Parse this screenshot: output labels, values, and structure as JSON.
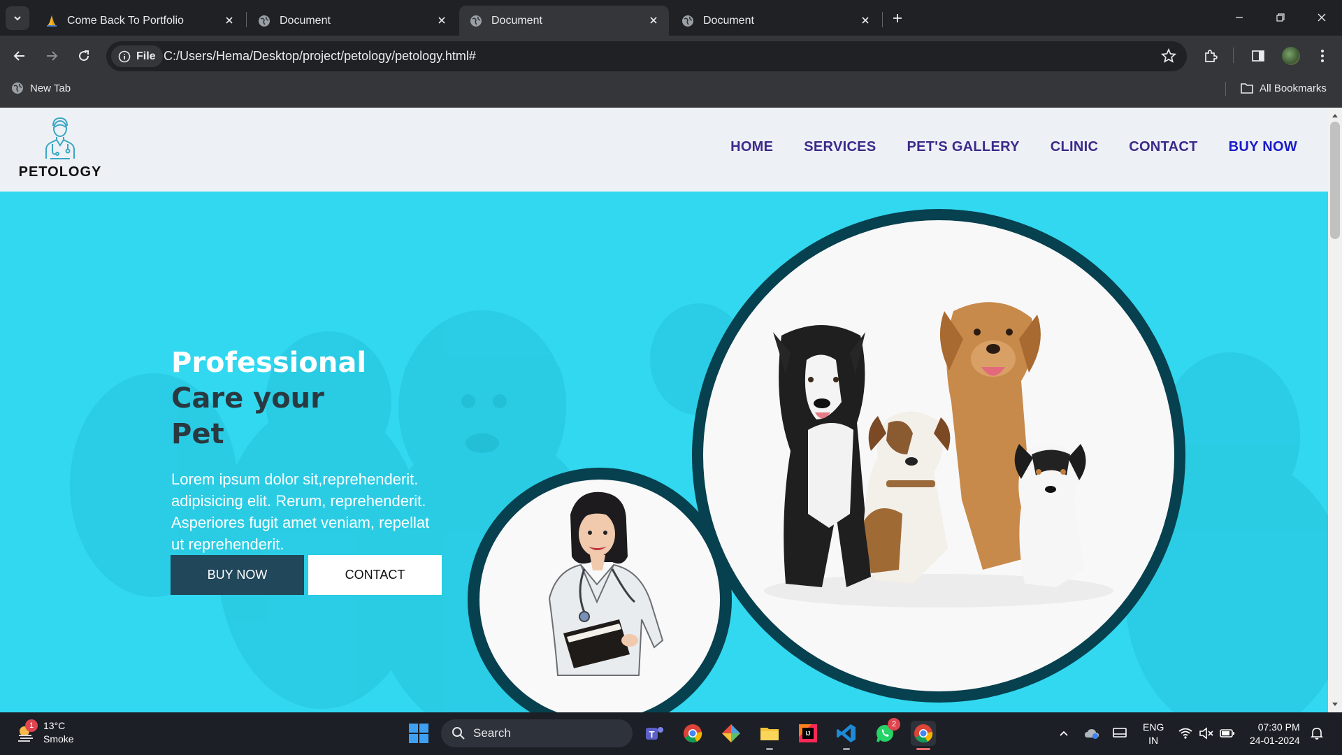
{
  "browser": {
    "tabs": [
      {
        "title": "Come Back To Portfolio",
        "active": false
      },
      {
        "title": "Document",
        "active": false
      },
      {
        "title": "Document",
        "active": true
      },
      {
        "title": "Document",
        "active": false
      }
    ],
    "site_chip": "File",
    "url": "C:/Users/Hema/Desktop/project/petology/petology.html#",
    "bookmarks": {
      "left": "New Tab",
      "right": "All Bookmarks"
    }
  },
  "site": {
    "logo_text": "PETOLOGY",
    "nav": [
      "HOME",
      "SERVICES",
      "PET'S GALLERY",
      "CLINIC",
      "CONTACT",
      "BUY NOW"
    ],
    "hero": {
      "title_line1": "Professional",
      "title_line2": "Care your",
      "title_line3": "Pet",
      "text": "Lorem ipsum dolor sit,reprehenderit. adipisicing elit. Rerum, reprehenderit. Asperiores fugit amet veniam, repellat ut reprehenderit.",
      "btn_primary": "BUY NOW",
      "btn_secondary": "CONTACT"
    },
    "colors": {
      "hero_bg": "#31d8f0",
      "circle_ring": "#07404e",
      "nav_text": "#3d2a8a",
      "primary_button": "#21475a"
    }
  },
  "taskbar": {
    "weather": {
      "temp": "13°C",
      "condition": "Smoke",
      "badge": "1"
    },
    "search": "Search",
    "whatsapp_badge": "2",
    "lang": {
      "line1": "ENG",
      "line2": "IN"
    },
    "clock": {
      "time": "07:30 PM",
      "date": "24-01-2024"
    }
  }
}
